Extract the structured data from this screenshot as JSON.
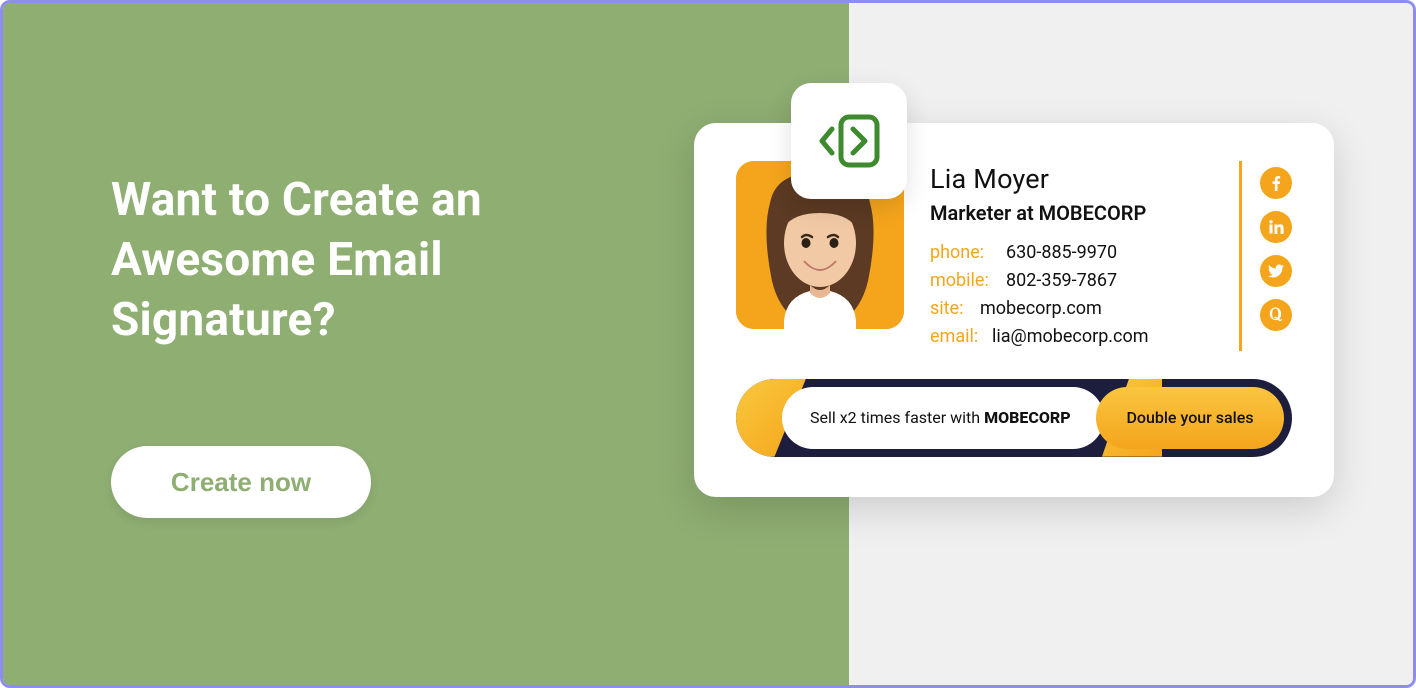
{
  "promo": {
    "headline": "Want to Create an Awesome Email Signature?",
    "cta": "Create now"
  },
  "signature": {
    "name": "Lia Moyer",
    "title": "Marketer at MOBECORP",
    "contacts": {
      "phone_label": "phone:",
      "phone_value": "630-885-9970",
      "mobile_label": "mobile:",
      "mobile_value": "802-359-7867",
      "site_label": "site:",
      "site_value": "mobecorp.com",
      "email_label": "email:",
      "email_value": "lia@mobecorp.com"
    },
    "banner": {
      "text_prefix": "Sell x2 times faster with ",
      "text_bold": "MOBECORP",
      "button": "Double your sales"
    }
  },
  "colors": {
    "green": "#8eae72",
    "orange": "#f4a51c",
    "navy": "#1d1d3d",
    "border": "#8d8df0"
  }
}
